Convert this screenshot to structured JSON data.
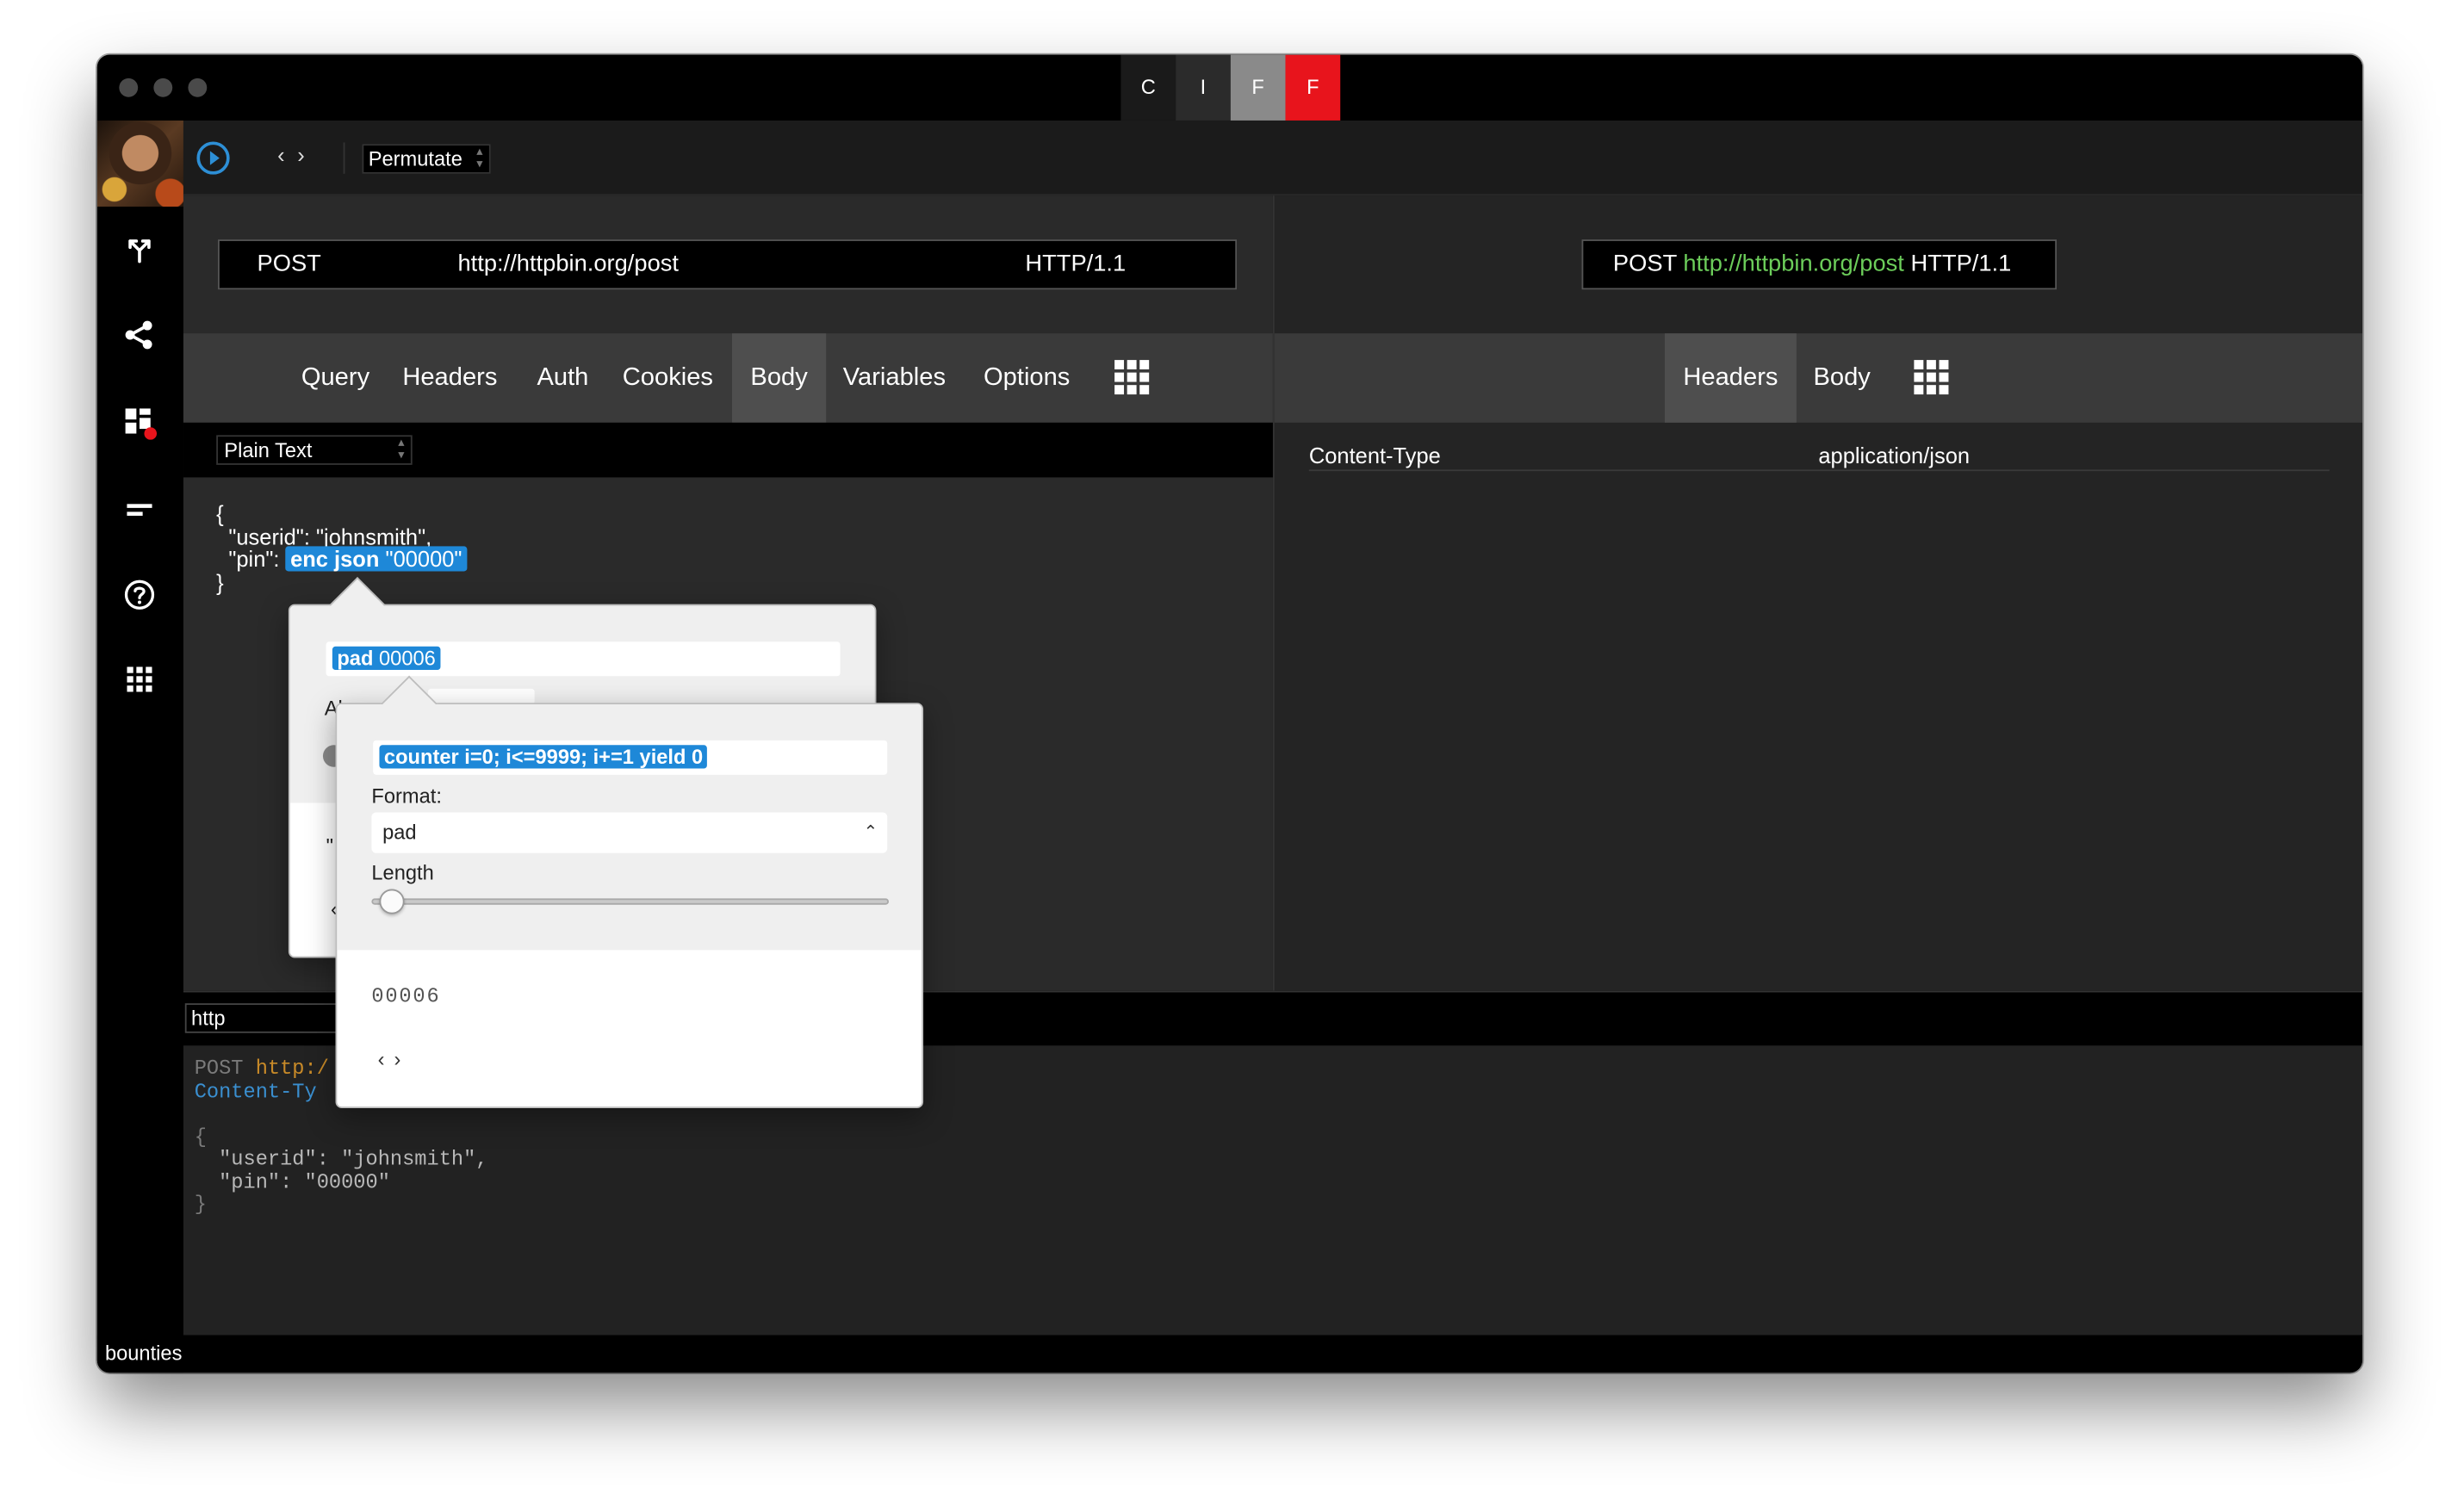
{
  "titlebar": {
    "tabs": [
      {
        "label": "C",
        "bg": "#1a1a1a"
      },
      {
        "label": "I",
        "bg": "#2b2b2b"
      },
      {
        "label": "F",
        "bg": "#8a8a8a"
      },
      {
        "label": "F",
        "bg": "#e8141c"
      }
    ]
  },
  "sidebar": {
    "icons": [
      "merge-icon",
      "share-icon",
      "dashboard-icon",
      "menu-lines-icon",
      "help-icon",
      "apps-grid-icon"
    ],
    "notification_color": "#e8141c"
  },
  "toolbar": {
    "prev_label": "‹",
    "next_label": "›",
    "mode_select": "Permutate",
    "accent": "#2d8fd6"
  },
  "request": {
    "method": "POST",
    "url": "http://httpbin.org/post",
    "protocol": "HTTP/1.1",
    "tabs": [
      "Query",
      "Headers",
      "Auth",
      "Cookies",
      "Body",
      "Variables",
      "Options"
    ],
    "active_tab": "Body",
    "body_type": "Plain Text",
    "body": {
      "open_brace": "{",
      "line1": "  \"userid\": \"johnsmith\",",
      "line2_prefix": "  \"pin\": ",
      "tag_fn": "enc json",
      "tag_arg": " \"00000\"",
      "close_brace": "}"
    }
  },
  "response": {
    "method": "POST",
    "url": "http://httpbin.org/post",
    "protocol": "HTTP/1.1",
    "tabs": [
      "Headers",
      "Body"
    ],
    "active_tab": "Headers",
    "headers": [
      {
        "name": "Content-Type",
        "value": "application/json"
      }
    ]
  },
  "popover_pad": {
    "tag_fn": "pad",
    "tag_arg": " 00006",
    "partial_label": "Al",
    "partial_quote": "\"",
    "partial_nav": "‹"
  },
  "popover_counter": {
    "tag_text": "counter i=0; i<=9999; i+=1 yield 0",
    "format_label": "Format:",
    "format_value": "pad",
    "length_label": "Length",
    "length_fraction": 0.04,
    "preview_value": "00006",
    "prev_label": "‹",
    "next_label": "›"
  },
  "raw": {
    "format_input": "http",
    "lines": [
      {
        "parts": [
          {
            "t": "POST ",
            "c": "c-gray"
          },
          {
            "t": "http:/",
            "c": "c-orange"
          }
        ]
      },
      {
        "parts": [
          {
            "t": "Content-Ty",
            "c": "c-blue"
          }
        ]
      },
      {
        "parts": [
          {
            "t": "",
            "c": "c-gray"
          }
        ]
      },
      {
        "parts": [
          {
            "t": "{",
            "c": "c-gray"
          }
        ]
      },
      {
        "parts": [
          {
            "t": "  \"userid\": \"johnsmith\",",
            "c": "c-light"
          }
        ]
      },
      {
        "parts": [
          {
            "t": "  \"pin\": \"00000\"",
            "c": "c-light"
          }
        ]
      },
      {
        "parts": [
          {
            "t": "}",
            "c": "c-gray"
          }
        ]
      }
    ]
  },
  "status": {
    "text": "bounties"
  }
}
